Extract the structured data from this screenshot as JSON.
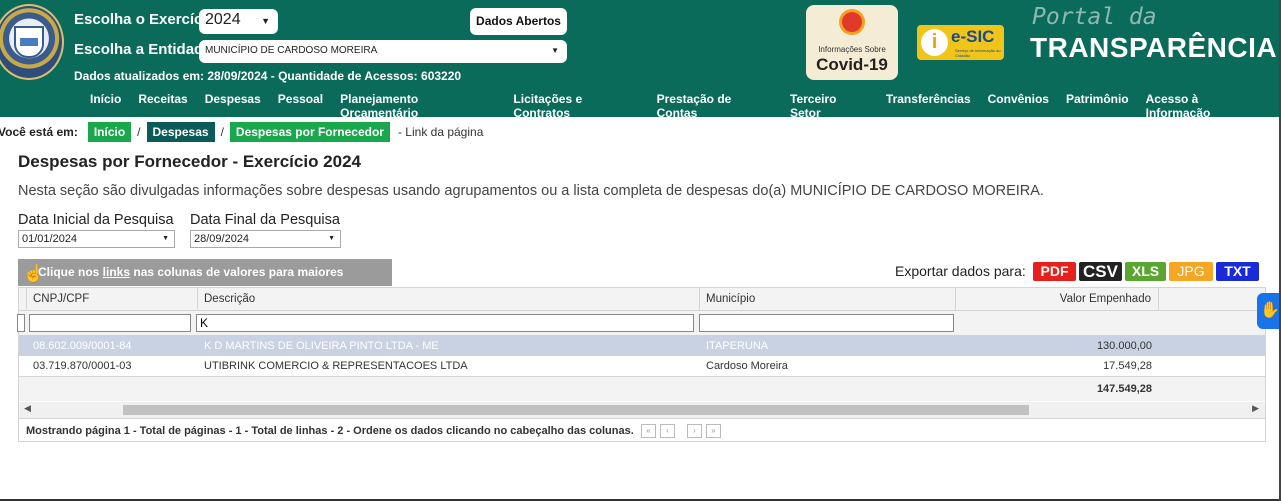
{
  "header": {
    "exercicio_label": "Escolha o Exercício:",
    "exercicio_value": "2024",
    "entidade_label": "Escolha a Entidade:",
    "entidade_value": "MUNICÍPIO DE CARDOSO MOREIRA",
    "dados_abertos": "Dados Abertos",
    "updated": "Dados atualizados em: 28/09/2024 - Quantidade de Acessos: 603220",
    "covid_line1": "Informações Sobre",
    "covid_line2": "Covid-19",
    "esic": "e-SIC",
    "esic_sub": "Serviço de Informação ao Cidadão",
    "portal_line1": "Portal da",
    "portal_line2": "TRANSPARÊNCIA",
    "bg_color": "#0b6b5b"
  },
  "nav": [
    "Início",
    "Receitas",
    "Despesas",
    "Pessoal",
    "Planejamento Orçamentário",
    "Licitações e Contratos",
    "Prestação de Contas",
    "Terceiro Setor",
    "Transferências",
    "Convênios",
    "Patrimônio",
    "Acesso à Informação"
  ],
  "breadcrumb": {
    "label": "Você está em:",
    "items": [
      "Início",
      "Despesas",
      "Despesas por Fornecedor"
    ],
    "link": "- Link da página"
  },
  "page": {
    "title": "Despesas por Fornecedor - Exercício 2024",
    "description": "Nesta seção são divulgadas informações sobre despesas usando agrupamentos ou a lista completa de despesas do(a) MUNICÍPIO DE CARDOSO MOREIRA.",
    "data_inicial_label": "Data Inicial da Pesquisa",
    "data_inicial_value": "01/01/2024",
    "data_final_label": "Data Final da Pesquisa",
    "data_final_value": "28/09/2024",
    "hint_pre": "Clique nos ",
    "hint_link": "links",
    "hint_post": " nas colunas de valores para maiores informações",
    "export_label": "Exportar dados para:",
    "export_buttons": [
      "PDF",
      "CSV",
      "XLS",
      "JPG",
      "TXT"
    ]
  },
  "table": {
    "columns": [
      "CNPJ/CPF",
      "Descrição",
      "Município",
      "Valor Empenhado"
    ],
    "filter_descricao": "K",
    "rows": [
      [
        "08.602.009/0001-84",
        "K D MARTINS DE OLIVEIRA PINTO LTDA - ME",
        "ITAPERUNA",
        "130.000,00"
      ],
      [
        "03.719.870/0001-03",
        "UTIBRINK COMERCIO & REPRESENTACOES LTDA",
        "Cardoso Moreira",
        "17.549,28"
      ]
    ],
    "total": "147.549,28",
    "footer": "Mostrando página 1 - Total de páginas - 1 - Total de linhas - 2 - Ordene os dados clicando no cabeçalho das colunas."
  }
}
